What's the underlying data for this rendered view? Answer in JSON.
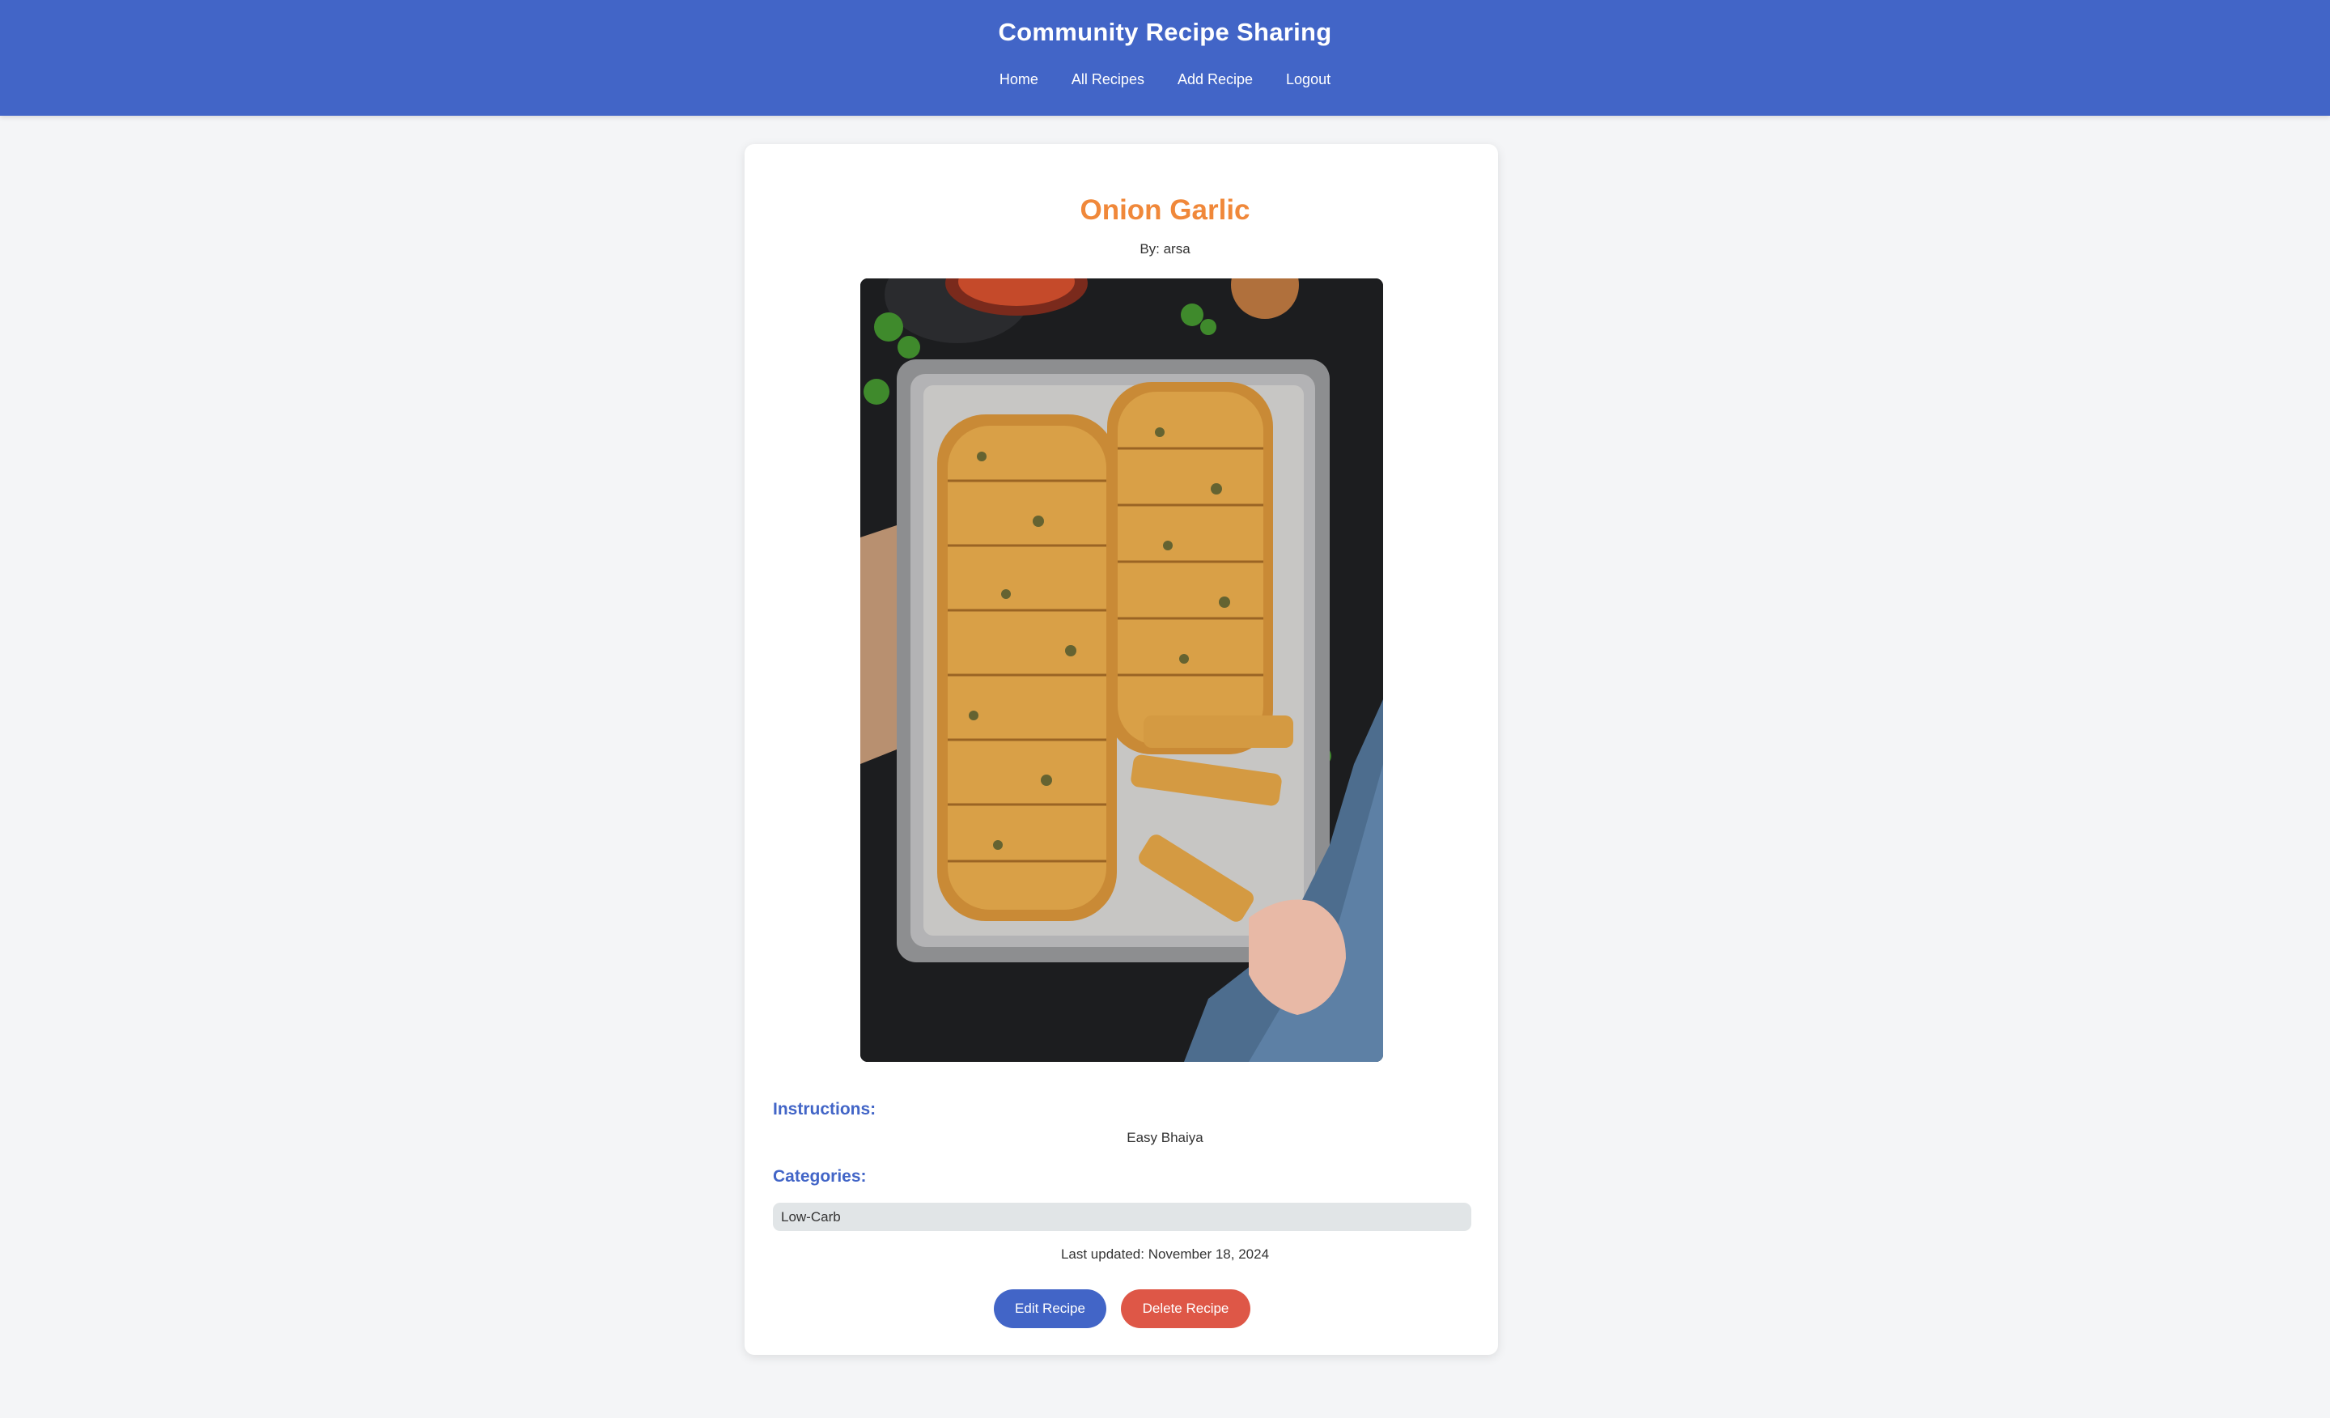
{
  "header": {
    "title": "Community Recipe Sharing",
    "nav": [
      "Home",
      "All Recipes",
      "Add Recipe",
      "Logout"
    ]
  },
  "recipe": {
    "title": "Onion Garlic",
    "author": "By: arsa",
    "image_description": "Garlic bread on baking tray",
    "instructions_label": "Instructions:",
    "instructions": "Easy Bhaiya",
    "categories_label": "Categories:",
    "categories": [
      "Low-Carb"
    ],
    "last_updated": "Last updated: November 18, 2024"
  },
  "actions": {
    "edit": "Edit Recipe",
    "delete": "Delete Recipe"
  },
  "colors": {
    "header_bg": "#4265c7",
    "title_accent": "#f0883a",
    "edit_button": "#4265c7",
    "delete_button": "#de5747",
    "page_bg": "#f4f5f7"
  }
}
